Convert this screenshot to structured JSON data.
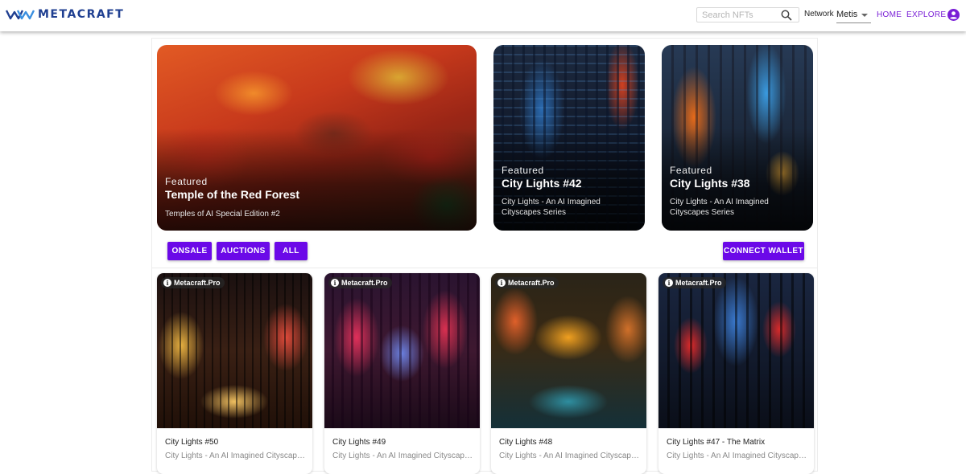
{
  "header": {
    "logo_text": "METACRAFT",
    "search_placeholder": "Search NFTs",
    "network_label": "Network",
    "network_value": "Metis",
    "nav": {
      "home": "HOME",
      "explore": "EXPLORE"
    }
  },
  "featured": [
    {
      "tag": "Featured",
      "title": "Temple of the Red Forest",
      "subtitle": "Temples of AI Special Edition #2"
    },
    {
      "tag": "Featured",
      "title": "City Lights #42",
      "subtitle": "City Lights - An AI Imagined Cityscapes Series"
    },
    {
      "tag": "Featured",
      "title": "City Lights #38",
      "subtitle": "City Lights - An AI Imagined Cityscapes Series"
    }
  ],
  "filters": {
    "onsale": "ONSALE",
    "auctions": "AUCTIONS",
    "all": "ALL"
  },
  "connect_wallet": "CONNECT WALLET",
  "cards": [
    {
      "badge": "Metacraft.Pro",
      "title": "City Lights #50",
      "subtitle": "City Lights - An AI Imagined Cityscapes ..."
    },
    {
      "badge": "Metacraft.Pro",
      "title": "City Lights #49",
      "subtitle": "City Lights - An AI Imagined Cityscapes ..."
    },
    {
      "badge": "Metacraft.Pro",
      "title": "City Lights #48",
      "subtitle": "City Lights - An AI Imagined Cityscapes ..."
    },
    {
      "badge": "Metacraft.Pro",
      "title": "City Lights #47 - The Matrix",
      "subtitle": "City Lights - An AI Imagined Cityscapes ..."
    }
  ],
  "colors": {
    "accent": "#6b09e8",
    "nav_link": "#7a1fd6",
    "logo": "#1f3f91"
  }
}
